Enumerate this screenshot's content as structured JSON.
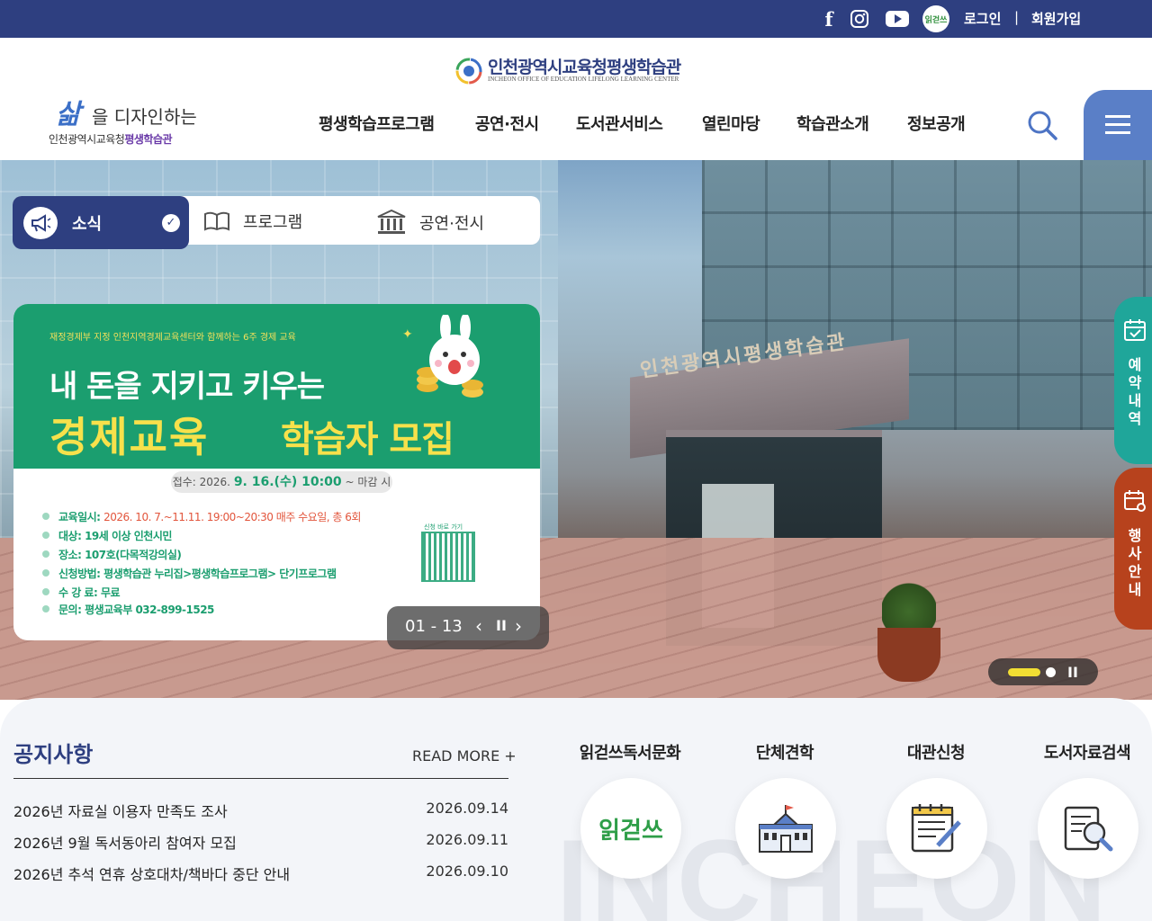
{
  "topbar": {
    "social": [
      "facebook-icon",
      "instagram-icon",
      "youtube-icon",
      "irudam-icon"
    ],
    "irudam_label": "읽걷쓰",
    "login": "로그인",
    "separator": "|",
    "join": "회원가입"
  },
  "header": {
    "center_title": "인천광역시교육청평생학습관",
    "center_subtitle": "INCHEON OFFICE OF EDUCATION LIFELONG LEARNING CENTER",
    "slogan_big": "삶",
    "slogan": "을 디자인하는",
    "org_prefix": "인천광역시교육청",
    "org_suffix": "평생학습관",
    "nav": [
      "평생학습프로그램",
      "공연·전시",
      "도서관서비스",
      "열린마당",
      "학습관소개",
      "정보공개"
    ]
  },
  "hero": {
    "tabs": [
      {
        "label": "소식",
        "icon": "megaphone-icon",
        "active": true
      },
      {
        "label": "프로그램",
        "icon": "book-icon"
      },
      {
        "label": "공연·전시",
        "icon": "museum-icon"
      }
    ],
    "building_sign": "인천광역시평생학습관",
    "banner": {
      "kicker": "재정경제부 지정 인천지역경제교육센터와 함께하는 6주 경제 교육",
      "headline1": "내 돈을 지키고 키우는",
      "headline2a": "경제교육",
      "headline2b": "학습자 모집",
      "deadline_prefix": "접수: 2026.",
      "deadline_date": "9. 16.(수) 10:00",
      "deadline_suffix": "~ 마감 시",
      "info": [
        {
          "key": "교육일시: ",
          "value": "2026. 10. 7.~11.11. 19:00~20:30 매주 수요일, 총 6회",
          "red": true
        },
        {
          "key": "대상: ",
          "value": "19세 이상 인천시민"
        },
        {
          "key": "장소: ",
          "value": "107호(다목적강의실)"
        },
        {
          "key": "신청방법: ",
          "value": "평생학습관 누리집>평생학습프로그램> 단기프로그램"
        },
        {
          "key": "수 강 료: ",
          "value": "무료"
        },
        {
          "key": "문의: ",
          "value": "평생교육부 032-899-1525"
        }
      ],
      "qr_label": "신청 바로 가기"
    },
    "counter": {
      "current": "01",
      "sep": " - ",
      "total": "13",
      "prev": "‹",
      "pause": "II",
      "next": "›"
    },
    "indicator_pause": "II"
  },
  "side_menu": [
    {
      "label": "예약내역",
      "color": "#1fa69a",
      "icon": "calendar-check-icon"
    },
    {
      "label": "행사안내",
      "color": "#b7421d",
      "icon": "calendar-gear-icon"
    }
  ],
  "notice": {
    "title": "공지사항",
    "read_more": "READ MORE +",
    "items": [
      {
        "title": "2026년 자료실 이용자 만족도 조사",
        "date": "2026.09.14"
      },
      {
        "title": "2026년 9월 독서동아리 참여자 모집",
        "date": "2026.09.11"
      },
      {
        "title": "2026년 추석 연휴 상호대차/책바다 중단 안내",
        "date": "2026.09.10"
      }
    ]
  },
  "quick_links": [
    {
      "label": "읽걷쓰독서문화",
      "icon": "irudam-logo-icon",
      "logo_text": "읽걷쓰"
    },
    {
      "label": "단체견학",
      "icon": "school-building-icon"
    },
    {
      "label": "대관신청",
      "icon": "form-pencil-icon"
    },
    {
      "label": "도서자료검색",
      "icon": "document-search-icon"
    }
  ],
  "background_word": "INCHEON",
  "colors": {
    "navy": "#2e3f80",
    "menu_blue": "#5a7fc7",
    "green": "#1b9e6f",
    "yellow": "#f7e14b",
    "teal": "#1fa69a",
    "brick": "#b7421d"
  }
}
